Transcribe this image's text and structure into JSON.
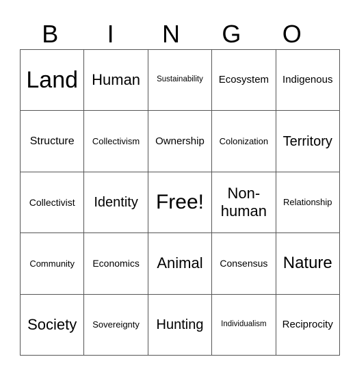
{
  "header": {
    "letters": [
      "B",
      "I",
      "N",
      "G",
      "O"
    ]
  },
  "rows": [
    [
      "Land",
      "Human",
      "Sustainability",
      "Ecosystem",
      "Indigenous"
    ],
    [
      "Structure",
      "Collectivism",
      "Ownership",
      "Colonization",
      "Territory"
    ],
    [
      "Collectivist",
      "Identity",
      "Free!",
      "Non-human",
      "Relationship"
    ],
    [
      "Community",
      "Economics",
      "Animal",
      "Consensus",
      "Nature"
    ],
    [
      "Society",
      "Sovereignty",
      "Hunting",
      "Individualism",
      "Reciprocity"
    ]
  ]
}
